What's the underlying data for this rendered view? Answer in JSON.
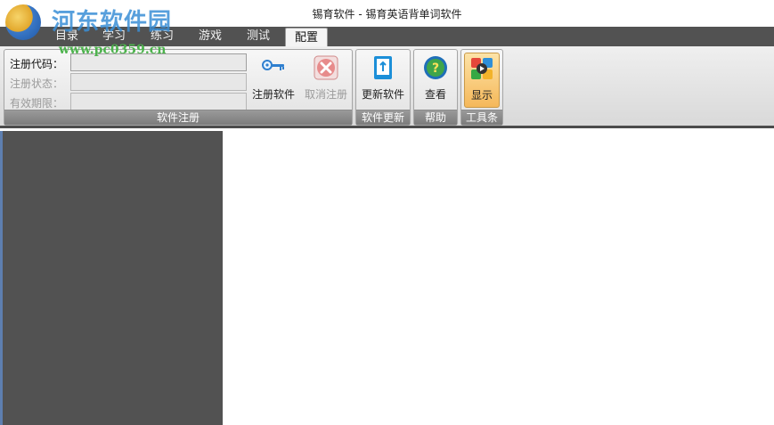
{
  "window": {
    "title": "锡育软件 - 锡育英语背单词软件"
  },
  "watermark": {
    "text": "河东软件园",
    "url": "www.pc0359.cn"
  },
  "tabs": [
    {
      "label": "目录"
    },
    {
      "label": "学习"
    },
    {
      "label": "练习"
    },
    {
      "label": "游戏"
    },
    {
      "label": "测试"
    },
    {
      "label": "配置"
    }
  ],
  "ribbon": {
    "registration": {
      "group_label": "软件注册",
      "code_label": "注册代码：",
      "code_value": "",
      "status_label": "注册状态：",
      "status_value": "",
      "expiry_label": "有效期限：",
      "expiry_value": "",
      "register_button": "注册软件",
      "cancel_button": "取消注册"
    },
    "update": {
      "group_label": "软件更新",
      "update_button": "更新软件"
    },
    "help": {
      "group_label": "帮助",
      "view_button": "查看"
    },
    "toolbar": {
      "group_label": "工具条",
      "show_button": "显示"
    }
  },
  "colors": {
    "tabbar": "#525252",
    "panel": "#525252",
    "pressed_button": "#f5b85a",
    "watermark": "#3a8fd6"
  }
}
